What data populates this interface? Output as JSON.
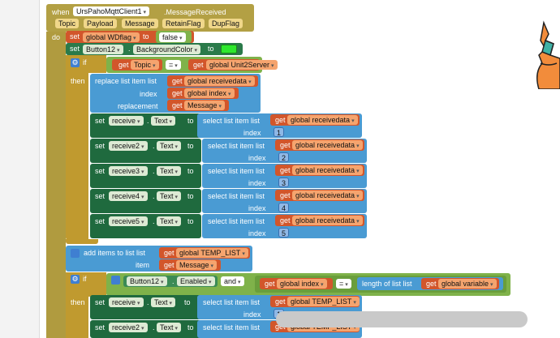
{
  "event": {
    "when_label": "when",
    "component": "UrsPahoMqttClient1",
    "event_name": ".MessageReceived",
    "params": [
      "Topic",
      "Payload",
      "Message",
      "RetainFlag",
      "DupFlag"
    ],
    "do_label": "do"
  },
  "kw": {
    "set": "set",
    "to": "to",
    "get": "get",
    "if": "if",
    "then": "then",
    "dot": ".",
    "eq": "=",
    "and": "and",
    "list": "list",
    "index": "index",
    "item": "item",
    "replacement": "replacement"
  },
  "stmt1": {
    "var": "global WDflag",
    "value": "false"
  },
  "stmt2": {
    "component": "Button12",
    "prop": "BackgroundColor",
    "color": "#2ee82e"
  },
  "if1": {
    "lhs": "Topic",
    "rhs": "global Unit2Server"
  },
  "replace": {
    "label": "replace list item",
    "list": "global receivedata",
    "index": "global index",
    "replacement": "Message"
  },
  "select_label": "select list item",
  "select_list": "global receivedata",
  "receives": [
    {
      "comp": "receive",
      "prop": "Text",
      "index": "1"
    },
    {
      "comp": "receive2",
      "prop": "Text",
      "index": "2"
    },
    {
      "comp": "receive3",
      "prop": "Text",
      "index": "3"
    },
    {
      "comp": "receive4",
      "prop": "Text",
      "index": "4"
    },
    {
      "comp": "receive5",
      "prop": "Text",
      "index": "5"
    }
  ],
  "additems": {
    "label": "add items to list",
    "list": "global TEMP_LIST",
    "item": "Message"
  },
  "if2": {
    "comp": "Button12",
    "prop": "Enabled",
    "and_label": "and",
    "lhs": "global index",
    "length_label": "length of list",
    "length_list": "global variable"
  },
  "then2": [
    {
      "comp": "receive",
      "prop": "Text",
      "list": "global TEMP_LIST",
      "index": "1"
    },
    {
      "comp": "receive2",
      "prop": "Text",
      "list": "global TEMP_LIST"
    }
  ],
  "colors": {
    "event": "#b3a044",
    "set": "#2a7a4a",
    "list": "#4a9bd3",
    "get": "#d2562b",
    "logic": "#7fb24a",
    "control": "#c09a2f"
  }
}
